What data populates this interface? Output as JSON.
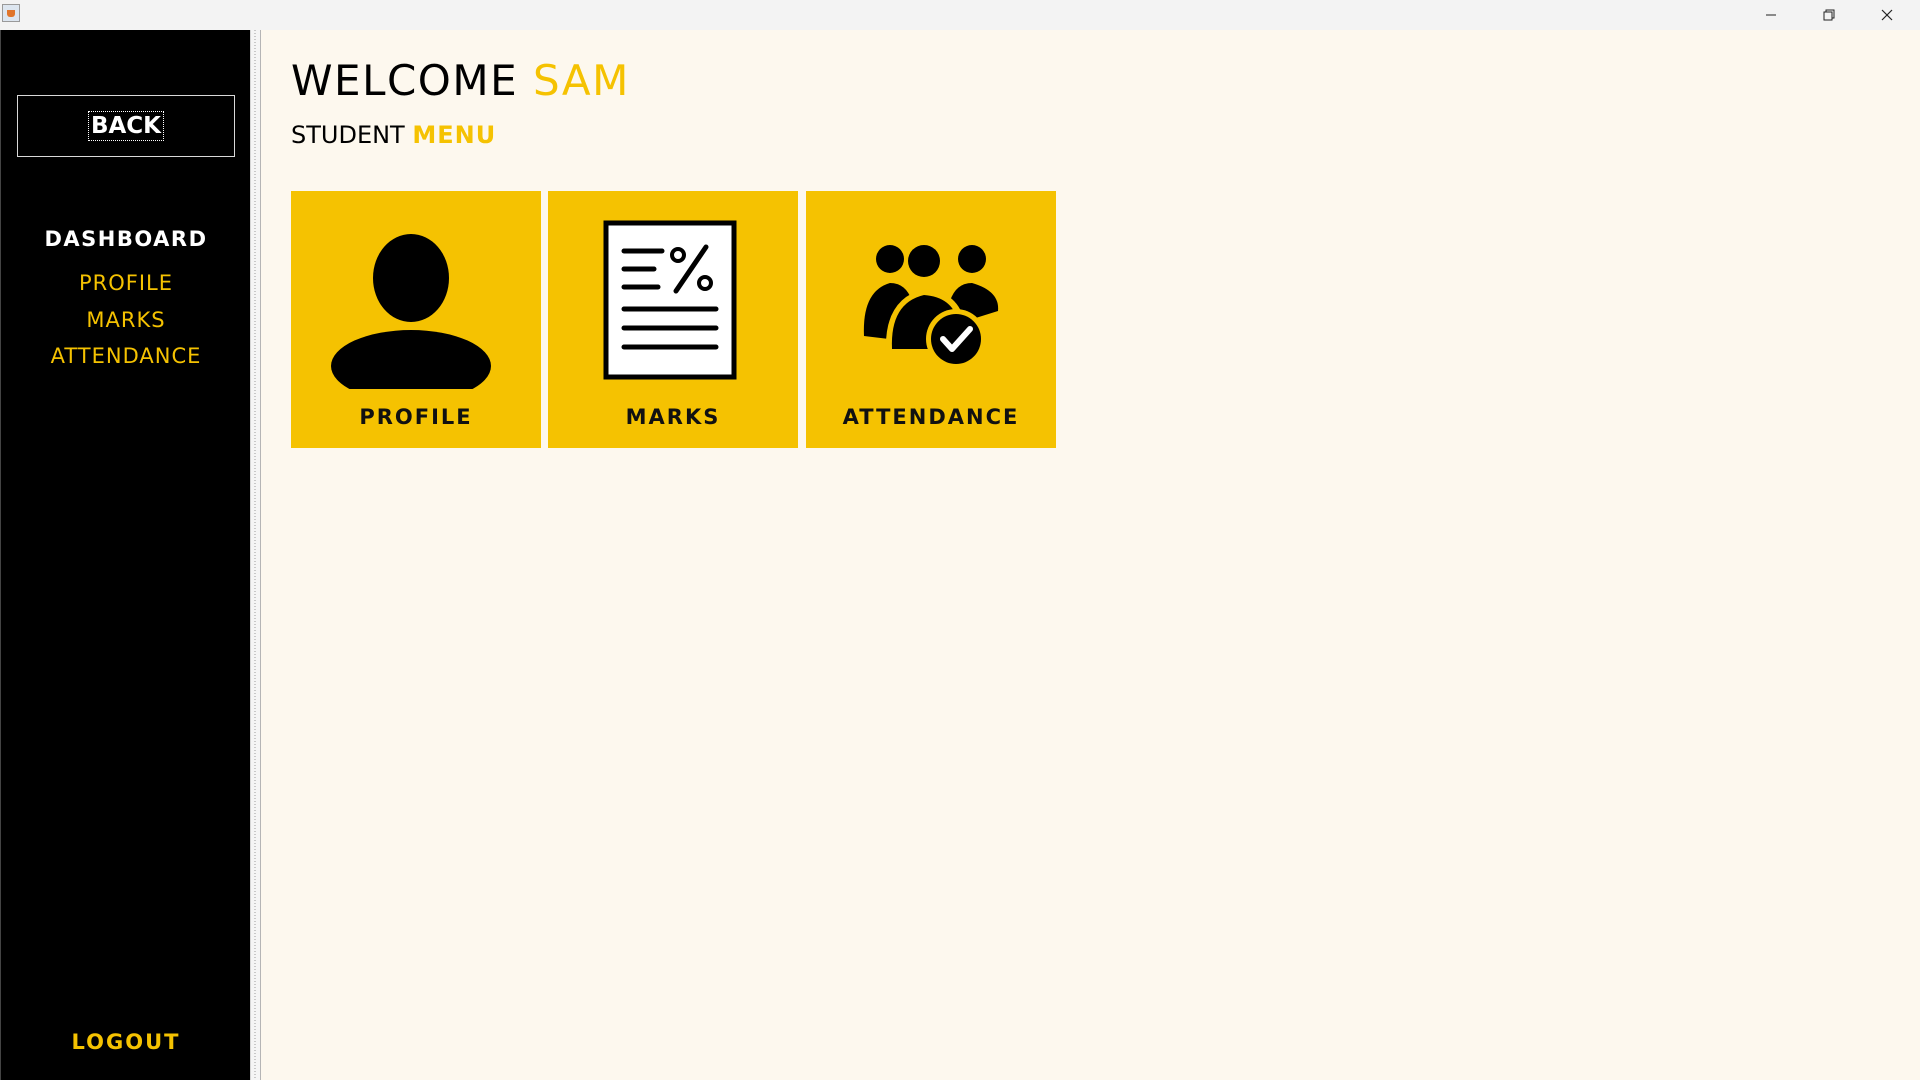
{
  "window": {
    "icon": "java-cup-icon"
  },
  "sidebar": {
    "back_label": "BACK",
    "title": "DASHBOARD",
    "items": [
      {
        "label": "PROFILE"
      },
      {
        "label": "MARKS"
      },
      {
        "label": "ATTENDANCE"
      }
    ],
    "logout_label": "LOGOUT"
  },
  "header": {
    "welcome_text": "WELCOME",
    "user_name": "SAM",
    "subtitle_main": "STUDENT",
    "subtitle_accent": "MENU"
  },
  "tiles": [
    {
      "label": "PROFILE",
      "icon": "user-icon"
    },
    {
      "label": "MARKS",
      "icon": "document-percent-icon"
    },
    {
      "label": "ATTENDANCE",
      "icon": "group-check-icon"
    }
  ],
  "colors": {
    "accent": "#f5c201",
    "sidebar_bg": "#000000",
    "main_bg": "#fdf8ee"
  }
}
